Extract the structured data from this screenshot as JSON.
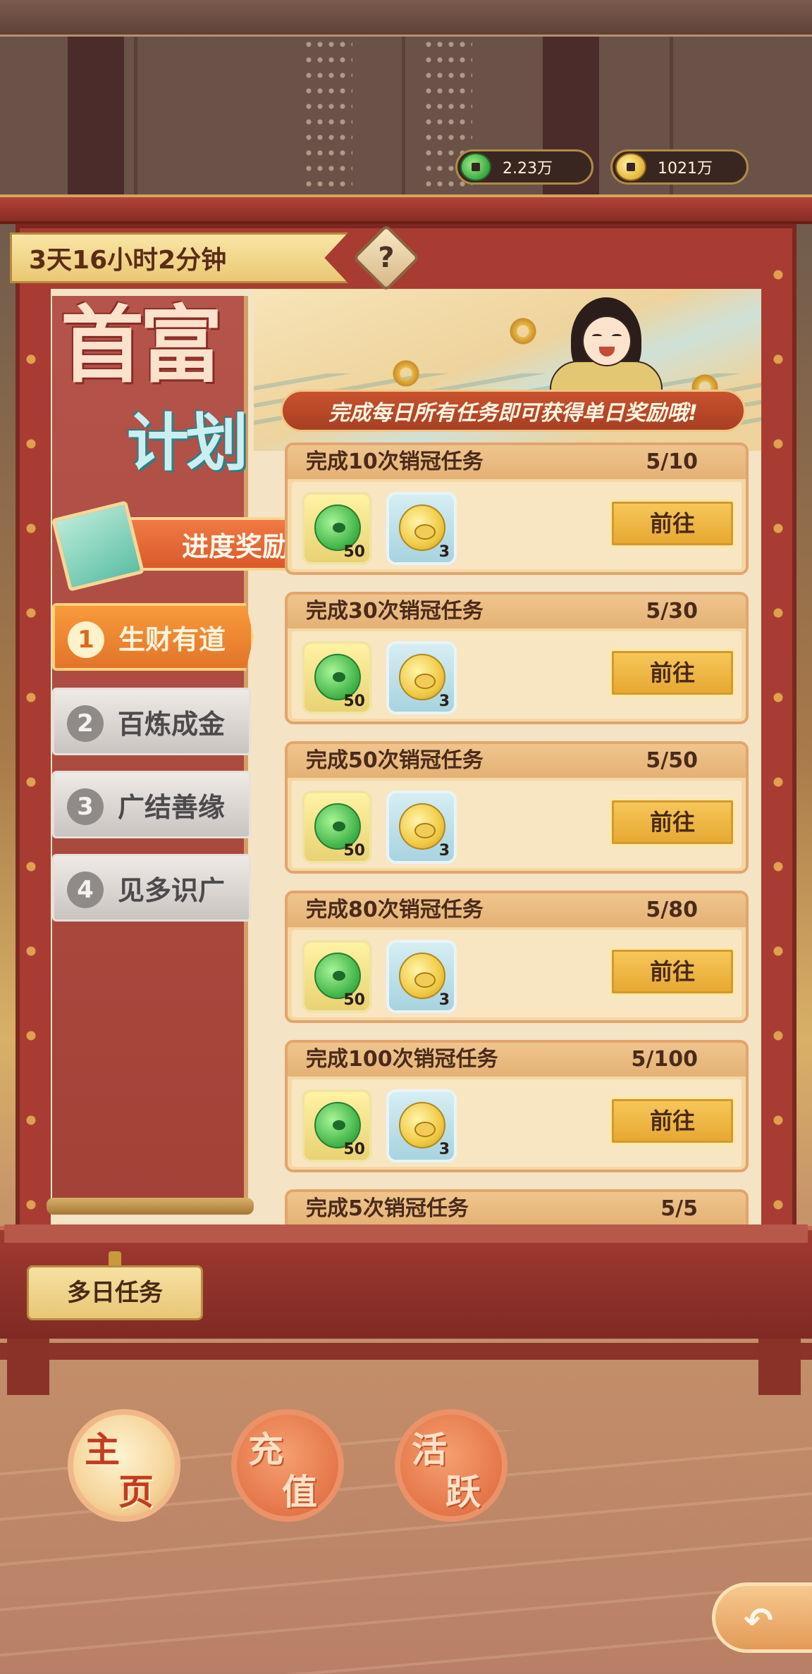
{
  "currency": {
    "jade": {
      "icon": "jade-coin-icon",
      "value": "2.23万"
    },
    "gold": {
      "icon": "gold-coin-icon",
      "value": "1021万"
    }
  },
  "timer": "3天16小时2分钟",
  "help_label": "?",
  "event": {
    "title_line1": "首富",
    "title_line2": "计划",
    "notice": "完成每日所有任务即可获得单日奖励哦!"
  },
  "progress_reward_label": "进度奖励",
  "tabs": [
    {
      "num": "1",
      "label": "生财有道",
      "active": true
    },
    {
      "num": "2",
      "label": "百炼成金",
      "active": false
    },
    {
      "num": "3",
      "label": "广结善缘",
      "active": false
    },
    {
      "num": "4",
      "label": "见多识广",
      "active": false
    }
  ],
  "tasks": [
    {
      "title": "完成10次销冠任务",
      "progress": "5/10",
      "rewards": [
        {
          "icon": "jade-coin-icon",
          "count": "50"
        },
        {
          "icon": "gold-pig-coin-icon",
          "count": "3"
        }
      ],
      "button": "前往"
    },
    {
      "title": "完成30次销冠任务",
      "progress": "5/30",
      "rewards": [
        {
          "icon": "jade-coin-icon",
          "count": "50"
        },
        {
          "icon": "gold-pig-coin-icon",
          "count": "3"
        }
      ],
      "button": "前往"
    },
    {
      "title": "完成50次销冠任务",
      "progress": "5/50",
      "rewards": [
        {
          "icon": "jade-coin-icon",
          "count": "50"
        },
        {
          "icon": "gold-pig-coin-icon",
          "count": "3"
        }
      ],
      "button": "前往"
    },
    {
      "title": "完成80次销冠任务",
      "progress": "5/80",
      "rewards": [
        {
          "icon": "jade-coin-icon",
          "count": "50"
        },
        {
          "icon": "gold-pig-coin-icon",
          "count": "3"
        }
      ],
      "button": "前往"
    },
    {
      "title": "完成100次销冠任务",
      "progress": "5/100",
      "rewards": [
        {
          "icon": "jade-coin-icon",
          "count": "50"
        },
        {
          "icon": "gold-pig-coin-icon",
          "count": "3"
        }
      ],
      "button": "前往"
    },
    {
      "title": "完成5次销冠任务",
      "progress": "5/5"
    }
  ],
  "multi_day_button": "多日任务",
  "bottom_nav": [
    {
      "line1": "主",
      "line2": "页",
      "selected": true
    },
    {
      "line1": "充",
      "line2": "值",
      "selected": false
    },
    {
      "line1": "活",
      "line2": "跃",
      "selected": false
    }
  ],
  "back_button_icon": "back-arrow-icon",
  "colors": {
    "frame_red": "#a83c32",
    "accent_orange": "#e3742a",
    "button_gold": "#e6a72f",
    "parchment": "#f4e3c4"
  }
}
